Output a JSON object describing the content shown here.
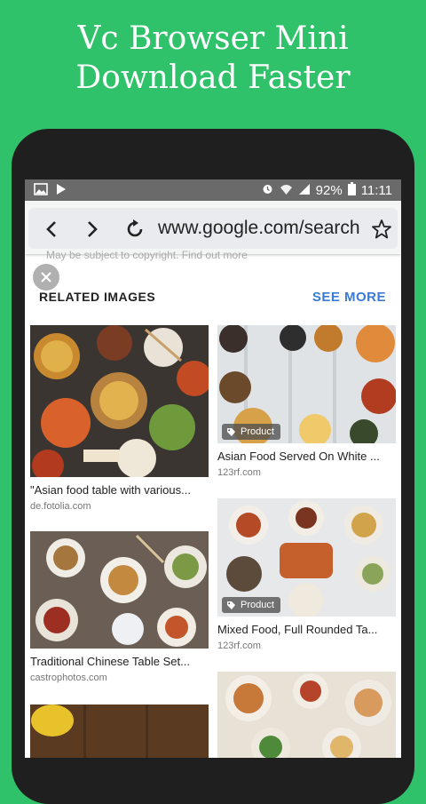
{
  "promo": {
    "line1": "Vc Browser Mini",
    "line2": "Download Faster"
  },
  "status_bar": {
    "battery": "92%",
    "time": "11:11"
  },
  "browser": {
    "url": "www.google.com/search"
  },
  "page": {
    "peek_text": "May be subject to copyright. Find out more",
    "related_title": "RELATED IMAGES",
    "see_more": "SEE MORE"
  },
  "results": [
    {
      "caption": "\"Asian food table with various...",
      "source": "de.fotolia.com",
      "badge": ""
    },
    {
      "caption": "Asian Food Served On White ...",
      "source": "123rf.com",
      "badge": "Product"
    },
    {
      "caption": "Traditional Chinese Table Set...",
      "source": "castrophotos.com",
      "badge": ""
    },
    {
      "caption": "Mixed Food, Full Rounded Ta...",
      "source": "123rf.com",
      "badge": "Product"
    }
  ],
  "colors": {
    "brand_green": "#2fc26a",
    "link_blue": "#3b7bd6"
  }
}
